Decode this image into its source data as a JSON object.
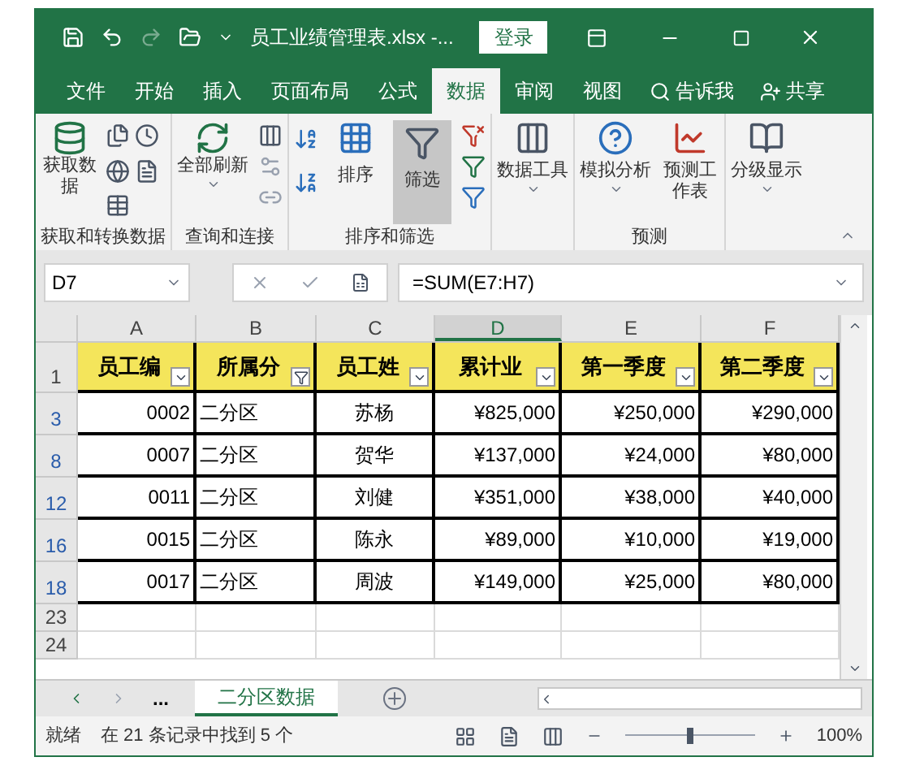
{
  "title_bar": {
    "title": "员工业绩管理表.xlsx -...",
    "login": "登录"
  },
  "tabs": [
    {
      "label": "文件",
      "selected": false
    },
    {
      "label": "开始",
      "selected": false
    },
    {
      "label": "插入",
      "selected": false
    },
    {
      "label": "页面布局",
      "selected": false
    },
    {
      "label": "公式",
      "selected": false
    },
    {
      "label": "数据",
      "selected": true
    },
    {
      "label": "审阅",
      "selected": false
    },
    {
      "label": "视图",
      "selected": false
    }
  ],
  "tell_me": "告诉我",
  "share": "共享",
  "ribbon": {
    "get_data": "获取数据",
    "refresh_all": "全部刷新",
    "sort": "排序",
    "filter": {
      "label": "筛选",
      "on": true
    },
    "data_tools": "数据工具",
    "what_if": "模拟分析",
    "forecast_sheet": "预测工作表",
    "outline": "分级显示",
    "group_labels": [
      "获取和转换数据",
      "查询和连接",
      "排序和筛选",
      "预测"
    ]
  },
  "name_box": "D7",
  "formula": "=SUM(E7:H7)",
  "columns": [
    {
      "letter": "A",
      "selected": false
    },
    {
      "letter": "B",
      "selected": false
    },
    {
      "letter": "C",
      "selected": false
    },
    {
      "letter": "D",
      "selected": true
    },
    {
      "letter": "E",
      "selected": false
    },
    {
      "letter": "F",
      "selected": false
    }
  ],
  "header_row": {
    "row": "1",
    "cells": [
      {
        "text": "员工编",
        "filtered": false
      },
      {
        "text": "所属分",
        "filtered": true
      },
      {
        "text": "员工姓",
        "filtered": false
      },
      {
        "text": "累计业",
        "filtered": false
      },
      {
        "text": "第一季度",
        "filtered": false
      },
      {
        "text": "第二季度",
        "filtered": false
      }
    ]
  },
  "rows": [
    {
      "row": "3",
      "cells": [
        "0002",
        "二分区",
        "苏杨",
        "¥825,000",
        "¥250,000",
        "¥290,000"
      ]
    },
    {
      "row": "8",
      "cells": [
        "0007",
        "二分区",
        "贺华",
        "¥137,000",
        "¥24,000",
        "¥80,000"
      ]
    },
    {
      "row": "12",
      "cells": [
        "0011",
        "二分区",
        "刘健",
        "¥351,000",
        "¥38,000",
        "¥40,000"
      ]
    },
    {
      "row": "16",
      "cells": [
        "0015",
        "二分区",
        "陈永",
        "¥89,000",
        "¥10,000",
        "¥19,000"
      ]
    },
    {
      "row": "18",
      "cells": [
        "0017",
        "二分区",
        "周波",
        "¥149,000",
        "¥25,000",
        "¥80,000"
      ]
    }
  ],
  "empty_rows": [
    "23",
    "24"
  ],
  "sheet_tabs": {
    "more": "...",
    "tabs": [
      {
        "label": "二分区数据",
        "selected": true
      }
    ]
  },
  "status_bar": {
    "ready": "就绪",
    "message": "在 21 条记录中找到 5 个",
    "zoom": "100%",
    "zoom_level": {
      "level": 0.5
    }
  }
}
